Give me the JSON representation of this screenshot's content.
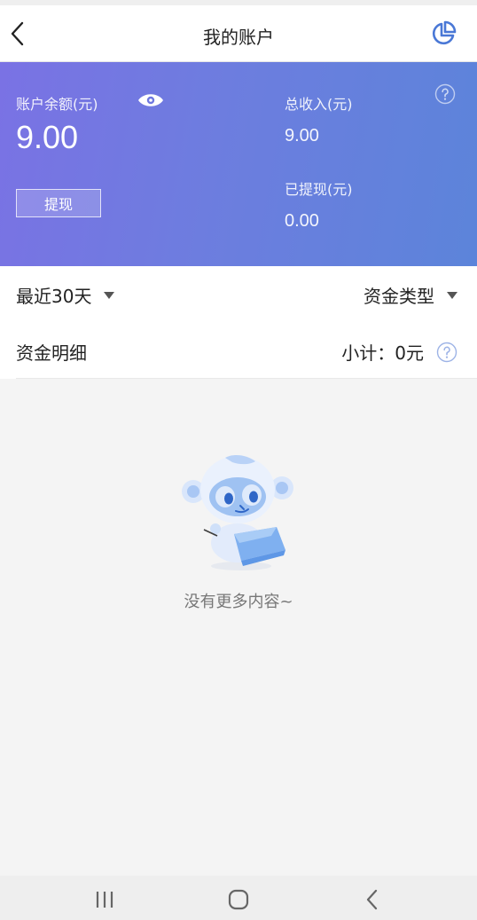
{
  "header": {
    "title": "我的账户",
    "back_icon": "chevron-left-icon",
    "stats_icon": "pie-chart-icon"
  },
  "account": {
    "balance_label": "账户余额(元)",
    "balance_value": "9.00",
    "withdraw_label": "提现",
    "total_income_label": "总收入(元)",
    "total_income_value": "9.00",
    "withdrawn_label": "已提现(元)",
    "withdrawn_value": "0.00"
  },
  "filters": {
    "period": "最近30天",
    "type": "资金类型"
  },
  "details": {
    "title": "资金明细",
    "subtotal": "小计：0元"
  },
  "empty": {
    "message": "没有更多内容~"
  },
  "colors": {
    "accent": "#4a78d6",
    "gradient_start": "#7a72e4",
    "gradient_end": "#5c84da"
  }
}
